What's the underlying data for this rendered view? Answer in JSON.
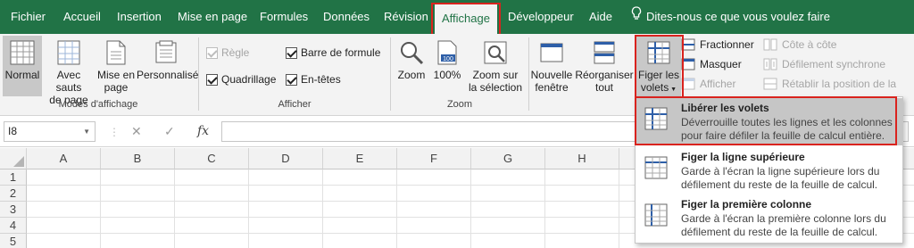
{
  "tabs": [
    {
      "label": "Fichier",
      "active": false
    },
    {
      "label": "Accueil",
      "active": false
    },
    {
      "label": "Insertion",
      "active": false
    },
    {
      "label": "Mise en page",
      "active": false
    },
    {
      "label": "Formules",
      "active": false
    },
    {
      "label": "Données",
      "active": false
    },
    {
      "label": "Révision",
      "active": false
    },
    {
      "label": "Affichage",
      "active": true
    },
    {
      "label": "Développeur",
      "active": false
    },
    {
      "label": "Aide",
      "active": false
    }
  ],
  "tell_me": {
    "icon": "lightbulb-icon",
    "label": "Dites-nous ce que vous voulez faire"
  },
  "ribbon": {
    "modes": {
      "normal": "Normal",
      "page_break_line1": "Avec sauts",
      "page_break_line2": "de page",
      "page_layout_line1": "Mise en",
      "page_layout_line2": "page",
      "custom": "Personnalisé",
      "group_label": "Modes d'affichage"
    },
    "show": {
      "ruler": {
        "label": "Règle",
        "checked": true,
        "disabled": true
      },
      "formula_bar": {
        "label": "Barre de formule",
        "checked": true
      },
      "gridlines": {
        "label": "Quadrillage",
        "checked": true
      },
      "headings": {
        "label": "En-têtes",
        "checked": true
      },
      "group_label": "Afficher"
    },
    "zoom": {
      "zoom": "Zoom",
      "hundred": "100%",
      "hundred_badge": "100",
      "selection_line1": "Zoom sur",
      "selection_line2": "la sélection",
      "group_label": "Zoom"
    },
    "window": {
      "new_window_line1": "Nouvelle",
      "new_window_line2": "fenêtre",
      "arrange_line1": "Réorganiser",
      "arrange_line2": "tout",
      "freeze_line1": "Figer les",
      "freeze_line2": "volets",
      "split": "Fractionner",
      "hide": "Masquer",
      "unhide": "Afficher",
      "side_by_side": "Côte à côte",
      "sync_scroll": "Défilement synchrone",
      "reset_position": "Rétablir la position de la"
    }
  },
  "formula_bar": {
    "cell_ref": "I8",
    "cancel": "✕",
    "enter": "✓",
    "fx": "fx",
    "value": ""
  },
  "columns": [
    "A",
    "B",
    "C",
    "D",
    "E",
    "F",
    "G",
    "H"
  ],
  "rows": [
    "1",
    "2",
    "3",
    "4",
    "5"
  ],
  "freeze_menu": [
    {
      "title": "Libérer les volets",
      "description": "Déverrouille toutes les lignes et les colonnes pour faire défiler la feuille de calcul entière.",
      "highlighted": true
    },
    {
      "title": "Figer la ligne supérieure",
      "description": "Garde à l'écran la ligne supérieure lors du défilement du reste de la feuille de calcul.",
      "highlighted": false
    },
    {
      "title": "Figer la première colonne",
      "description": "Garde à l'écran la première colonne lors du défilement du reste de la feuille de calcul.",
      "highlighted": false
    }
  ],
  "colors": {
    "excel_green": "#217346",
    "highlight_red": "#d9231e",
    "menu_highlight": "#c6c6c6"
  }
}
